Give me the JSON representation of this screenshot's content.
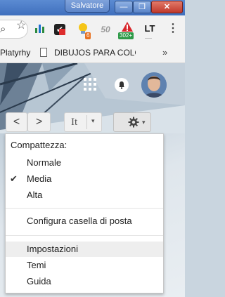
{
  "window": {
    "profile_name": "Salvatore",
    "minimize_glyph": "—",
    "maximize_glyph": "❐",
    "close_glyph": "✕"
  },
  "toolbar": {
    "extensions": [
      {
        "icon": "bar-chart-extension-icon",
        "text": "📊"
      },
      {
        "icon": "checkmark-extension-icon",
        "text": "✔"
      },
      {
        "icon": "lightbulb-extension-icon",
        "text": "💡",
        "badge": "6",
        "badge_color": "#e8711f"
      },
      {
        "icon": "speed-extension-icon",
        "text": "50"
      },
      {
        "icon": "warning-triangle-extension-icon",
        "text": "",
        "badge": "302+",
        "badge_color": "#2e9a48"
      },
      {
        "icon": "lt-extension-icon",
        "text": "LT",
        "subtext": "-----"
      }
    ],
    "menu_glyph": "⋮"
  },
  "bookmarks": {
    "items": [
      {
        "label": "Platyrhy"
      },
      {
        "label": "DIBUJOS PARA COLO"
      }
    ],
    "more_glyph": "»"
  },
  "gmail_toolbar": {
    "prev_glyph": "<",
    "next_glyph": ">",
    "input_tools_label": "It",
    "caret": "▾"
  },
  "settings_menu": {
    "density_header": "Compattezza:",
    "density_options": [
      {
        "label": "Normale",
        "checked": false
      },
      {
        "label": "Media",
        "checked": true
      },
      {
        "label": "Alta",
        "checked": false
      }
    ],
    "check_glyph": "✔",
    "configure_inbox": "Configura casella di posta",
    "settings": "Impostazioni",
    "themes": "Temi",
    "help": "Guida"
  }
}
